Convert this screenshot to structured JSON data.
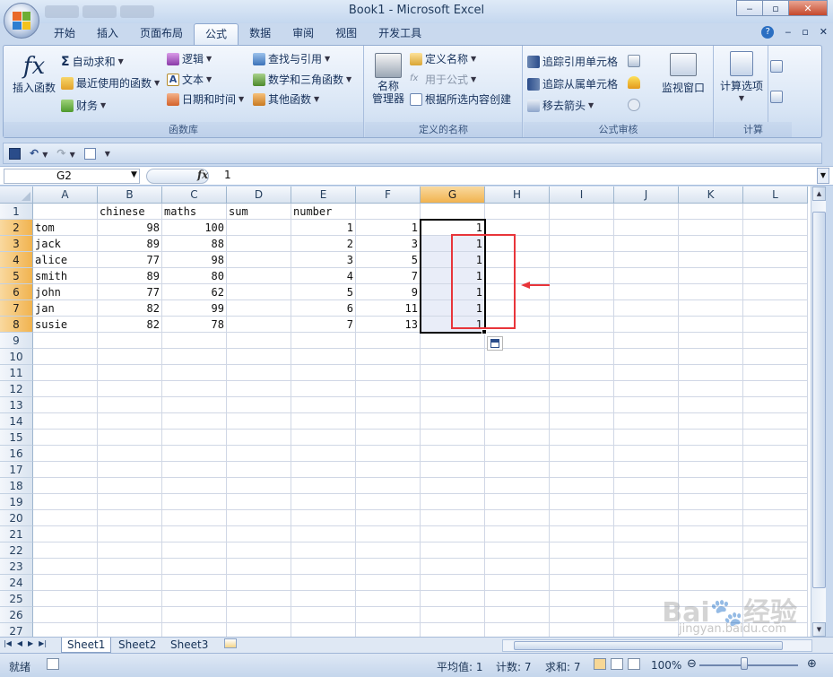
{
  "window": {
    "title": "Book1 - Microsoft Excel",
    "minimize": "‒",
    "restore": "▫",
    "close": "✕"
  },
  "ribbon_tabs": [
    "开始",
    "插入",
    "页面布局",
    "公式",
    "数据",
    "审阅",
    "视图",
    "开发工具"
  ],
  "active_tab": "公式",
  "ribbon": {
    "function_library": {
      "label": "函数库",
      "insert_function": "插入函数",
      "autosum": "自动求和",
      "recent": "最近使用的函数",
      "financial": "财务",
      "logical": "逻辑",
      "text": "文本",
      "datetime": "日期和时间",
      "lookup": "查找与引用",
      "math": "数学和三角函数",
      "more": "其他函数"
    },
    "defined_names": {
      "label": "定义的名称",
      "name_manager_1": "名称",
      "name_manager_2": "管理器",
      "define_name": "定义名称",
      "use_in_formula": "用于公式",
      "create_from_selection": "根据所选内容创建"
    },
    "formula_auditing": {
      "label": "公式审核",
      "trace_precedents": "追踪引用单元格",
      "trace_dependents": "追踪从属单元格",
      "remove_arrows": "移去箭头",
      "watch_window": "监视窗口"
    },
    "calculation": {
      "label": "计算",
      "options": "计算选项"
    }
  },
  "formula_bar": {
    "name_box": "G2",
    "fx": "fx",
    "value": "1"
  },
  "columns": [
    "A",
    "B",
    "C",
    "D",
    "E",
    "F",
    "G",
    "H",
    "I",
    "J",
    "K",
    "L"
  ],
  "selected_column": "G",
  "rows": [
    [
      "",
      "chinese",
      "maths",
      "sum",
      "number",
      "",
      ""
    ],
    [
      "tom",
      "98",
      "100",
      "",
      "1",
      "1",
      "1"
    ],
    [
      "jack",
      "89",
      "88",
      "",
      "2",
      "3",
      "1"
    ],
    [
      "alice",
      "77",
      "98",
      "",
      "3",
      "5",
      "1"
    ],
    [
      "smith",
      "89",
      "80",
      "",
      "4",
      "7",
      "1"
    ],
    [
      "john",
      "77",
      "62",
      "",
      "5",
      "9",
      "1"
    ],
    [
      "jan",
      "82",
      "99",
      "",
      "6",
      "11",
      "1"
    ],
    [
      "susie",
      "82",
      "78",
      "",
      "7",
      "13",
      "1"
    ]
  ],
  "row_count": 27,
  "sheets": [
    "Sheet1",
    "Sheet2",
    "Sheet3"
  ],
  "active_sheet": "Sheet1",
  "status": {
    "ready": "就绪",
    "average": "平均值: 1",
    "count": "计数: 7",
    "sum": "求和: 7",
    "zoom": "100%"
  },
  "watermark": {
    "brand": "Bai🐾经验",
    "url": "jingyan.baidu.com"
  },
  "colors": {
    "selection": "#000000",
    "highlight_box": "#e8353a",
    "header_selected": "#f4bd63"
  }
}
